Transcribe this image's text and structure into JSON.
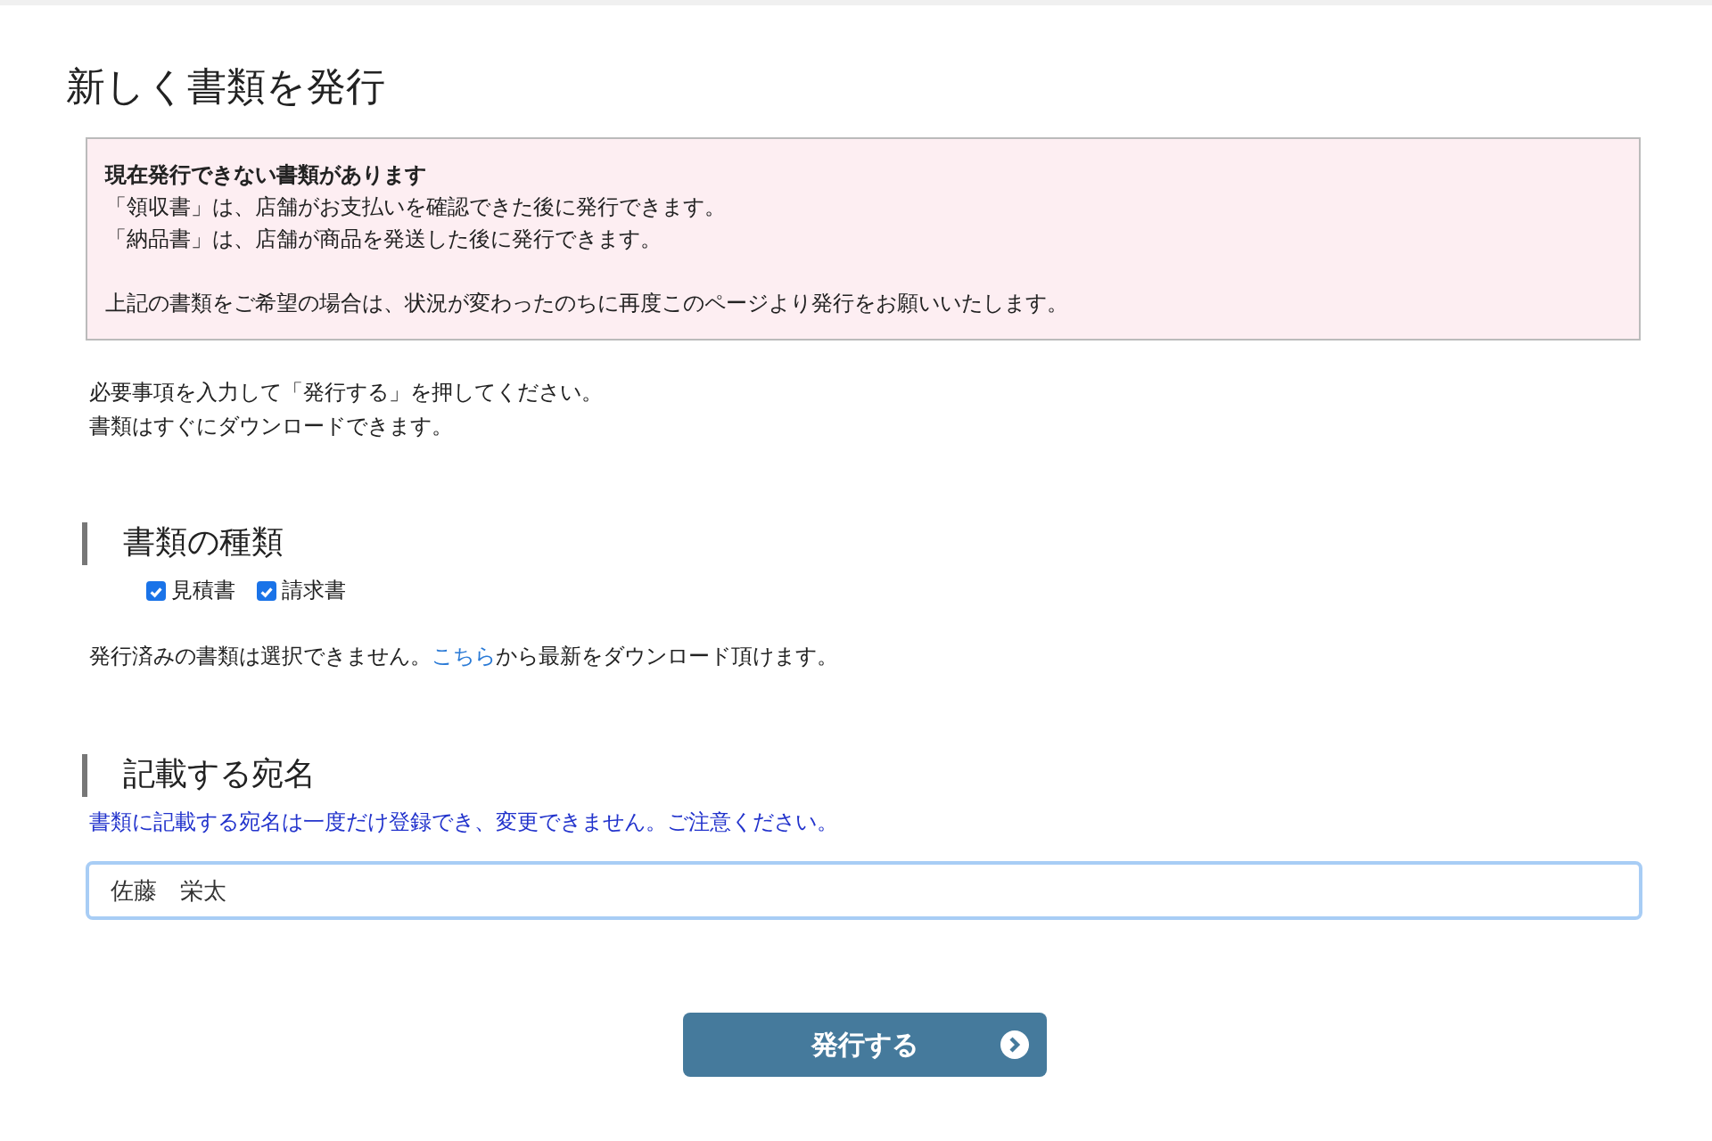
{
  "page_title": "新しく書類を発行",
  "notice": {
    "heading": "現在発行できない書類があります",
    "lines": [
      "「領収書」は、店舗がお支払いを確認できた後に発行できます。",
      "「納品書」は、店舗が商品を発送した後に発行できます。"
    ],
    "footer": "上記の書類をご希望の場合は、状況が変わったのちに再度このページより発行をお願いいたします。"
  },
  "intro": [
    "必要事項を入力して「発行する」を押してください。",
    "書類はすぐにダウンロードできます。"
  ],
  "document_types": {
    "heading": "書類の種類",
    "options": [
      {
        "label": "見積書",
        "checked": true
      },
      {
        "label": "請求書",
        "checked": true
      }
    ],
    "note_before": "発行済みの書類は選択できません。",
    "note_link": "こちら",
    "note_after": "から最新をダウンロード頂けます。"
  },
  "addressee": {
    "heading": "記載する宛名",
    "warning": "書類に記載する宛名は一度だけ登録でき、変更できません。ご注意ください。",
    "value": "佐藤　栄太"
  },
  "submit_button": "発行する"
}
